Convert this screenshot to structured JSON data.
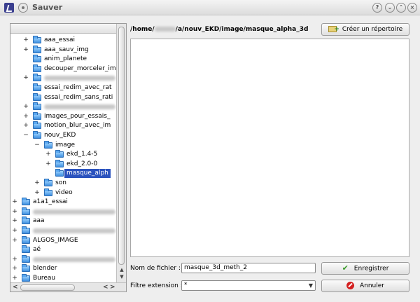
{
  "window": {
    "title": "Sauver",
    "help_btn": "?",
    "min_btn": "⌄",
    "max_btn": "⌃",
    "close_btn": "×"
  },
  "tree": {
    "items": [
      {
        "label": "aaa_essai",
        "depth": 2,
        "expander": "+"
      },
      {
        "label": "aaa_sauv_img",
        "depth": 2,
        "expander": "+"
      },
      {
        "label": "anim_planete",
        "depth": 2,
        "expander": ""
      },
      {
        "label": "decouper_morceler_im",
        "depth": 2,
        "expander": ""
      },
      {
        "label": "",
        "depth": 2,
        "expander": "+",
        "blurred": true
      },
      {
        "label": "essai_redim_avec_rat",
        "depth": 2,
        "expander": ""
      },
      {
        "label": "essai_redim_sans_rati",
        "depth": 2,
        "expander": ""
      },
      {
        "label": "",
        "depth": 2,
        "expander": "+",
        "blurred": true
      },
      {
        "label": "images_pour_essais_",
        "depth": 2,
        "expander": "+"
      },
      {
        "label": "motion_blur_avec_im",
        "depth": 2,
        "expander": "+"
      },
      {
        "label": "nouv_EKD",
        "depth": 2,
        "expander": "−"
      },
      {
        "label": "image",
        "depth": 3,
        "expander": "−"
      },
      {
        "label": "ekd_1.4-5",
        "depth": 4,
        "expander": "+"
      },
      {
        "label": "ekd_2.0-0",
        "depth": 4,
        "expander": "+"
      },
      {
        "label": "masque_alph",
        "depth": 4,
        "expander": "",
        "selected": true
      },
      {
        "label": "son",
        "depth": 3,
        "expander": "+"
      },
      {
        "label": "video",
        "depth": 3,
        "expander": "+"
      },
      {
        "label": "a1a1_essai",
        "depth": 1,
        "expander": "+"
      },
      {
        "label": "",
        "depth": 1,
        "expander": "+",
        "blurred": true
      },
      {
        "label": "aaa",
        "depth": 1,
        "expander": "+"
      },
      {
        "label": "",
        "depth": 1,
        "expander": "+",
        "blurred": true
      },
      {
        "label": "ALGOS_IMAGE",
        "depth": 1,
        "expander": "+"
      },
      {
        "label": "aé",
        "depth": 1,
        "expander": ""
      },
      {
        "label": "",
        "depth": 1,
        "expander": "+",
        "blurred": true
      },
      {
        "label": "blender",
        "depth": 1,
        "expander": "+"
      },
      {
        "label": "Bureau",
        "depth": 1,
        "expander": "+"
      }
    ],
    "scroll_left": "<",
    "scroll_right": ">",
    "scroll_up": "▲",
    "scroll_down": "▼"
  },
  "path": {
    "prefix": "/home/",
    "suffix": "/a/nouv_EKD/image/masque_alpha_3d"
  },
  "buttons": {
    "new_folder": "Créer un répertoire",
    "save": "Enregistrer",
    "cancel": "Annuler"
  },
  "form": {
    "filename_label": "Nom de fichier :",
    "filename_value": "masque_3d_meth_2",
    "filter_label": "Filtre extension :",
    "filter_value": "*"
  }
}
